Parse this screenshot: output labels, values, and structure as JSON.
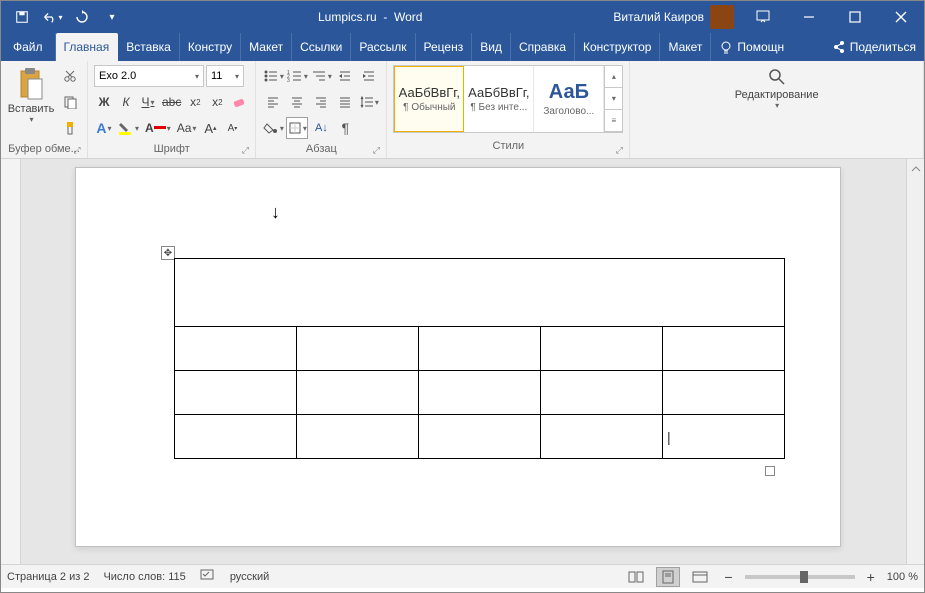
{
  "title": {
    "doc": "Lumpics.ru",
    "app": "Word"
  },
  "user": {
    "name": "Виталий Каиров"
  },
  "tabs": {
    "file": "Файл",
    "items": [
      "Главная",
      "Вставка",
      "Констру",
      "Макет",
      "Ссылки",
      "Рассылк",
      "Реценз",
      "Вид",
      "Справка",
      "Конструктор",
      "Макет"
    ],
    "active_index": 0,
    "help": "Помощн",
    "share": "Поделиться"
  },
  "ribbon": {
    "clipboard": {
      "paste": "Вставить",
      "label": "Буфер обме..."
    },
    "font": {
      "name": "Exo 2.0",
      "size": "11",
      "bold": "Ж",
      "italic": "К",
      "underline": "Ч",
      "strike": "abc",
      "label": "Шрифт"
    },
    "paragraph": {
      "label": "Абзац"
    },
    "styles": {
      "label": "Стили",
      "items": [
        {
          "preview": "АаБбВвГг,",
          "name": "¶ Обычный"
        },
        {
          "preview": "АаБбВвГг,",
          "name": "¶ Без инте..."
        },
        {
          "preview": "АаБ",
          "name": "Заголово..."
        }
      ]
    },
    "editing": {
      "label": "Редактирование"
    }
  },
  "status": {
    "page": "Страница 2 из 2",
    "words": "Число слов: 115",
    "language": "русский",
    "zoom": "100 %"
  }
}
